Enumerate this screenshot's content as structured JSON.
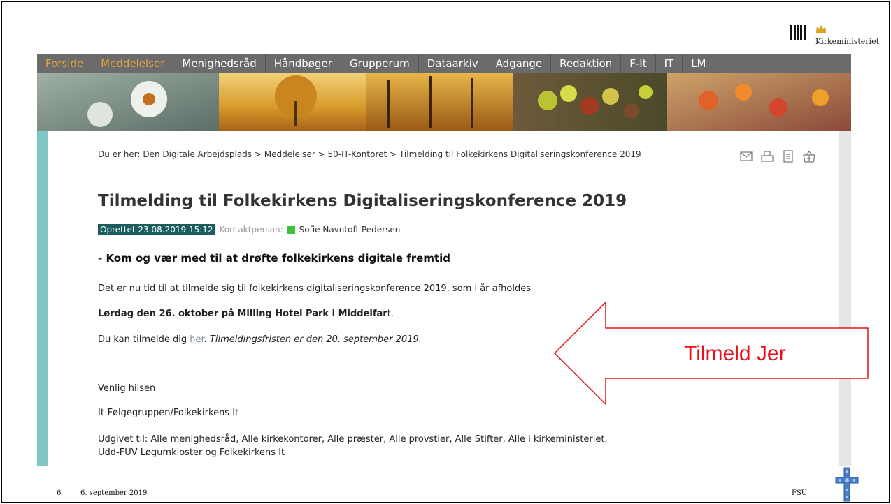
{
  "logo": {
    "text": "Kirkeministeriet"
  },
  "nav": {
    "items": [
      {
        "label": "Forside",
        "active": true
      },
      {
        "label": "Meddelelser",
        "active": true
      },
      {
        "label": "Menighedsråd",
        "active": false
      },
      {
        "label": "Håndbøger",
        "active": false
      },
      {
        "label": "Grupperum",
        "active": false
      },
      {
        "label": "Dataarkiv",
        "active": false
      },
      {
        "label": "Adgange",
        "active": false
      },
      {
        "label": "Redaktion",
        "active": false
      },
      {
        "label": "F-It",
        "active": false
      },
      {
        "label": "IT",
        "active": false
      },
      {
        "label": "LM",
        "active": false
      }
    ]
  },
  "breadcrumb": {
    "prefix": "Du er her:",
    "items": [
      "Den Digitale Arbejdsplads",
      "Meddelelser",
      "50-IT-Kontoret"
    ],
    "separator": ">",
    "current": "Tilmelding til Folkekirkens Digitaliseringskonference 2019"
  },
  "tools": [
    "mail-icon",
    "print-icon",
    "document-icon",
    "basket-icon"
  ],
  "article": {
    "title": "Tilmelding til Folkekirkens Digitaliseringskonference 2019",
    "created": "Oprettet 23.08.2019 15:12",
    "contact_label": "Kontaktperson:",
    "contact_name": "Sofie Navntoft Pedersen",
    "subtitle": "- Kom og vær med til at drøfte folkekirkens digitale fremtid",
    "intro": "Det er nu tid til at tilmelde sig til folkekirkens digitaliseringskonference 2019, som i år afholdes",
    "date_place_bold": "Lørdag den 26. oktober på Milling Hotel Park i Middelfar",
    "date_place_tail": "t.",
    "signup_prefix": "Du kan tilmelde dig ",
    "signup_link": "her",
    "signup_dot": ". ",
    "deadline": "Tilmeldingsfristen er den 20. september 2019.",
    "greeting": "Venlig hilsen",
    "sender": "It-Følgegruppen/Folkekirkens It",
    "published_to": "Udgivet til: Alle menighedsråd, Alle kirkekontorer, Alle præster, Alle provstier, Alle Stifter, Alle i kirkeministeriet, Udd-FUV Løgumkloster og Folkekirkens It"
  },
  "callout": {
    "text": "Tilmeld Jer",
    "color": "#e8101a"
  },
  "footer": {
    "slide_number": "6",
    "date": "6. september 2019",
    "org": "FSU"
  },
  "colors": {
    "nav_bg": "#6b6b6b",
    "nav_active": "#e3a33b",
    "accent": "#80c6c4",
    "created_badge": "#1b5d5c",
    "status": "#3bc23b"
  }
}
